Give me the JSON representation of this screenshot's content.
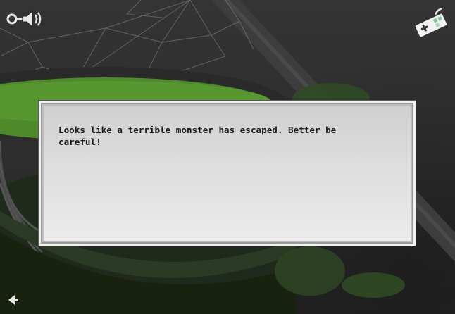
{
  "dialog": {
    "line1": "Looks like a terrible monster has escaped. Better be",
    "line2": "careful!"
  },
  "hud": {
    "sound_icon": "speaker-sound-on-icon",
    "controller_icon": "gamepad-controller-icon",
    "back_icon": "back-arrow-icon"
  },
  "colors": {
    "background": "#2f2f2f",
    "cauldron_liquid": "#4e8a2a",
    "cauldron_rim": "#2a2a2a",
    "dialog_fill": "#dcdcdc",
    "text": "#1a1a1a"
  }
}
